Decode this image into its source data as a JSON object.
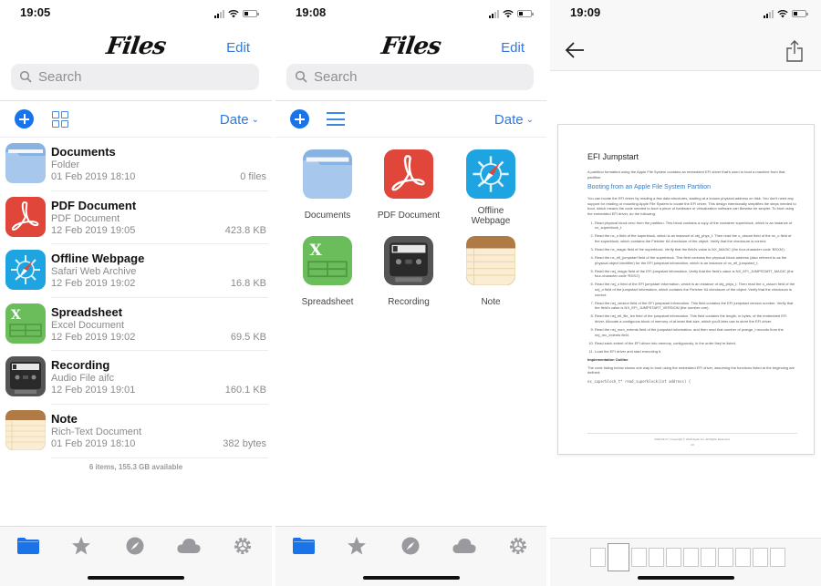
{
  "colors": {
    "accent": "#2f7ae0",
    "tab_active": "#1a73e8",
    "tab_inactive": "#9a9a9e"
  },
  "list_view": {
    "status": {
      "time": "19:05"
    },
    "title": "Files",
    "edit_label": "Edit",
    "search": {
      "placeholder": "Search"
    },
    "toolbar": {
      "add_icon": "plus-circle-icon",
      "view_toggle_icon": "grid-view-icon",
      "sort_label": "Date",
      "sort_chevron": "⌄"
    },
    "items": [
      {
        "name": "Documents",
        "kind": "Folder",
        "date": "01 Feb 2019 18:10",
        "size": "0 files",
        "icon": "folder-icon"
      },
      {
        "name": "PDF Document",
        "kind": "PDF Document",
        "date": "12 Feb 2019 19:05",
        "size": "423.8 KB",
        "icon": "pdf-icon"
      },
      {
        "name": "Offline Webpage",
        "kind": "Safari Web Archive",
        "date": "12 Feb 2019 19:02",
        "size": "16.8 KB",
        "icon": "safari-icon"
      },
      {
        "name": "Spreadsheet",
        "kind": "Excel Document",
        "date": "12 Feb 2019 19:02",
        "size": "69.5 KB",
        "icon": "spreadsheet-icon"
      },
      {
        "name": "Recording",
        "kind": "Audio File aifc",
        "date": "12 Feb 2019 19:01",
        "size": "160.1 KB",
        "icon": "recording-icon"
      },
      {
        "name": "Note",
        "kind": "Rich-Text Document",
        "date": "01 Feb 2019 18:10",
        "size": "382 bytes",
        "icon": "note-icon"
      }
    ],
    "footer": "6 items, 155.3 GB available",
    "tabs": [
      "folder-icon",
      "star-icon",
      "compass-icon",
      "cloud-icon",
      "gear-icon"
    ],
    "active_tab": 0
  },
  "grid_view": {
    "status": {
      "time": "19:08"
    },
    "title": "Files",
    "edit_label": "Edit",
    "search": {
      "placeholder": "Search"
    },
    "toolbar": {
      "add_icon": "plus-circle-icon",
      "view_toggle_icon": "list-view-icon",
      "sort_label": "Date",
      "sort_chevron": "⌄"
    },
    "items": [
      {
        "name": "Documents",
        "icon": "folder-icon"
      },
      {
        "name": "PDF Document",
        "icon": "pdf-icon"
      },
      {
        "name": "Offline Webpage",
        "icon": "safari-icon"
      },
      {
        "name": "Spreadsheet",
        "icon": "spreadsheet-icon"
      },
      {
        "name": "Recording",
        "icon": "recording-icon"
      },
      {
        "name": "Note",
        "icon": "note-icon"
      }
    ],
    "active_tab": 0
  },
  "viewer": {
    "status": {
      "time": "19:09"
    },
    "back_icon": "back-arrow-icon",
    "share_icon": "share-icon",
    "document": {
      "heading": "EFI Jumpstart",
      "intro": "A partition formatted using the Apple File System contains an embedded EFI driver that's used to boot a machine from that partition.",
      "subheading": "Booting from an Apple File System Partition",
      "para": "You can locate the EFI driver by reading a few data structures, starting at a known physical address on disk. You don't need any support for reading or mounting Apple File System to locate the EFI driver. This design intentionally simplifies the steps needed to boot, which means the code needed to boot a piece of hardware or virtualization software can likewise be simpler. To boot using the embedded EFI driver, do the following:",
      "steps": [
        "Read physical block zero from the partition. This block contains a copy of the container superblock, which is an instance of nx_superblock_t.",
        "Read the nx_o field of the superblock, which is an instance of obj_phys_t. Then read the o_cksum field of the nx_o field of the superblock, which contains the Fletcher 64 checksum of the object. Verify that the checksum is correct.",
        "Read the nx_magic field of the superblock. Verify that the field's value is NX_MAGIC (the four-character code 'BSXN').",
        "Read the nx_efi_jumpstart field of the superblock. This field contains the physical block address (also referred to as the physical object identifier) for the EFI jumpstart information, which is an instance of nx_efi_jumpstart_t.",
        "Read the nej_magic field of the EFI jumpstart information. Verify that the field's value is NX_EFI_JUMPSTART_MAGIC (the four-character code 'RDSJ').",
        "Read the nej_o field of the EFI jumpstart information, which is an instance of obj_phys_t. Then read the o_cksum field of the nej_o field of the jumpstart information, which contains the Fletcher 64 checksum of the object. Verify that the checksum is correct.",
        "Read the nej_version field of the EFI jumpstart information. This field contains the EFI jumpstart version number. Verify that the field's value is NX_EFI_JUMPSTART_VERSION (the number one).",
        "Read the nej_efi_file_len field of the jumpstart information. This field contains the length, in bytes, of the embedded EFI driver. Allocate a contiguous block of memory of at least that size, which you'll later use to store the EFI driver.",
        "Read the nej_num_extents field of the jumpstart information, and then read that number of prange_t records from the nej_rec_extents field.",
        "Read each extent of the EFI driver into memory, contiguously, in the order they're listed.",
        "Load the EFI driver and start executing it."
      ],
      "impl_heading": "Implementation Outline",
      "impl_text": "The code listing below shows one way to boot using the embedded EFI driver, assuming the functions listed at the beginning are defined:",
      "code": "nx_superblock_t* read_superblock(int address) {",
      "footer": "2018-09-17 | Copyright © 2018 Apple Inc. All Rights Reserved.",
      "page_number": "23"
    },
    "thumbnail_count": 11,
    "current_thumbnail": 1
  }
}
